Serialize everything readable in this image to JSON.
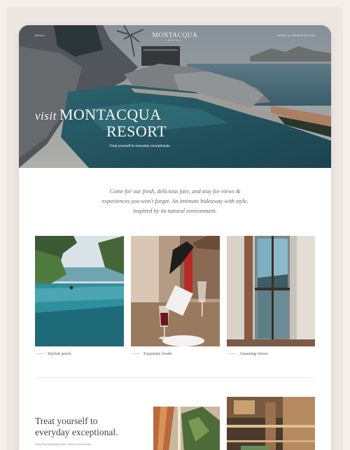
{
  "nav": {
    "menu_label": "MENU",
    "reserve_label": "MAKE A RESERVATION"
  },
  "brand": {
    "name": "MONTACQUA",
    "sub": "HOTEL"
  },
  "hero": {
    "visit": "visit",
    "title_line1": "MONTACQUA",
    "title_line2": "RESORT",
    "tagline": "Treat yourself to everyday exceptionals"
  },
  "intro": {
    "line1": "Come for our fresh, delicious fare, and stay for views &",
    "line2": "experiences you won't forget. An intimate hideaway with style,",
    "line3": "inspired by its natural environment."
  },
  "features": [
    {
      "label": "Stylish pools",
      "icon": "pool-photo"
    },
    {
      "label": "Exquisite foods",
      "icon": "wine-photo"
    },
    {
      "label": "Amazing views",
      "icon": "window-photo"
    }
  ],
  "bottom": {
    "title_line1": "Treat yourself to",
    "title_line2": "everyday exceptional.",
    "small": "Enjoy The Montacqua Hotel, which is seen all day."
  },
  "colors": {
    "page": "#f4efeb",
    "frame": "#ede6e1",
    "card": "#ffffff",
    "text": "#4a4340",
    "water": "#2f7f8e"
  }
}
